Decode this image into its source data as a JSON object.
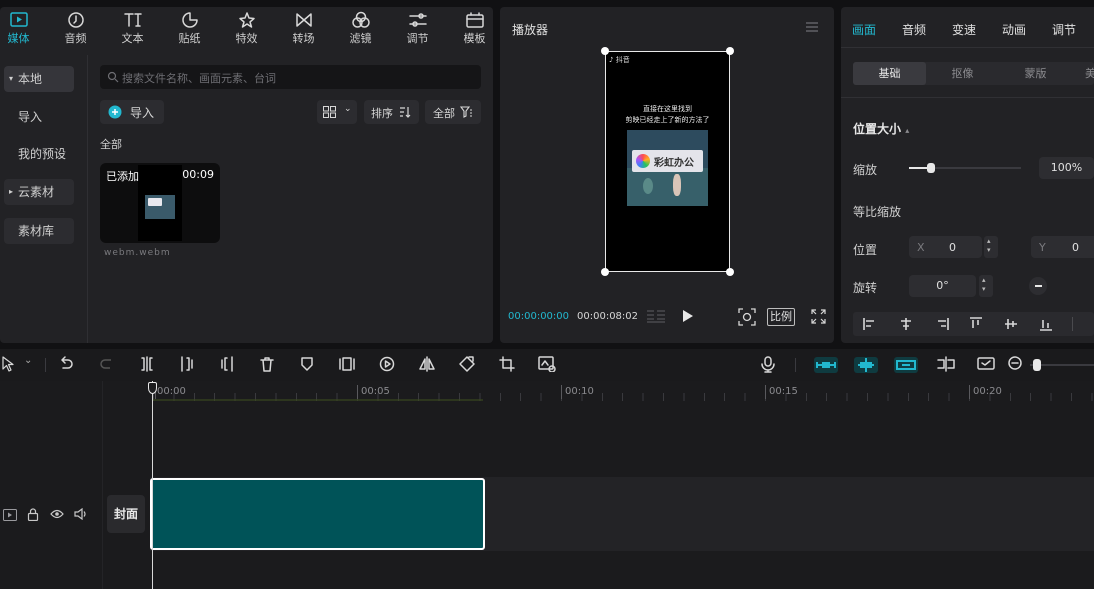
{
  "media_panel": {
    "tabs": [
      {
        "label": "媒体",
        "icon": "media-icon"
      },
      {
        "label": "音频",
        "icon": "audio-icon"
      },
      {
        "label": "文本",
        "icon": "text-icon"
      },
      {
        "label": "贴纸",
        "icon": "sticker-icon"
      },
      {
        "label": "特效",
        "icon": "effects-icon"
      },
      {
        "label": "转场",
        "icon": "transition-icon"
      },
      {
        "label": "滤镜",
        "icon": "filter-icon"
      },
      {
        "label": "调节",
        "icon": "adjust-icon"
      },
      {
        "label": "模板",
        "icon": "template-icon"
      }
    ],
    "sidebar": {
      "local": "本地",
      "import": "导入",
      "my_presets": "我的预设",
      "cloud": "云素材",
      "library": "素材库"
    },
    "search_placeholder": "搜索文件名称、画面元素、台词",
    "import_label": "导入",
    "sort_label": "排序",
    "filter_label": "全部",
    "section_label": "全部",
    "clip": {
      "added_badge": "已添加",
      "duration": "00:09",
      "filename": "webm.webm",
      "logo_text": "彩虹办公"
    }
  },
  "player": {
    "title": "播放器",
    "current_time": "00:00:00:00",
    "total_time": "00:00:08:02",
    "ratio_label": "比例",
    "video": {
      "caption_line1": "直接在这里找到",
      "caption_line2": "剪映已经走上了新的方法了",
      "logo_text": "彩虹办公",
      "tiktok_label": "抖音"
    }
  },
  "properties": {
    "tabs": [
      "画面",
      "音频",
      "变速",
      "动画",
      "调节"
    ],
    "subtabs": [
      "基础",
      "抠像",
      "蒙版",
      "美"
    ],
    "section_title": "位置大小",
    "scale_label": "缩放",
    "scale_value": "100%",
    "scale_level": 0.2,
    "uniform_scale_label": "等比缩放",
    "position_label": "位置",
    "pos_x_label": "X",
    "pos_x_value": "0",
    "pos_y_label": "Y",
    "pos_y_value": "0",
    "rotation_label": "旋转",
    "rotation_value": "0°"
  },
  "timeline": {
    "ticks": [
      "00:00",
      "00:05",
      "00:10",
      "00:15",
      "00:20"
    ],
    "cover_label": "封面",
    "accent_color": "#22b8cf",
    "clip_color": "#005358"
  }
}
